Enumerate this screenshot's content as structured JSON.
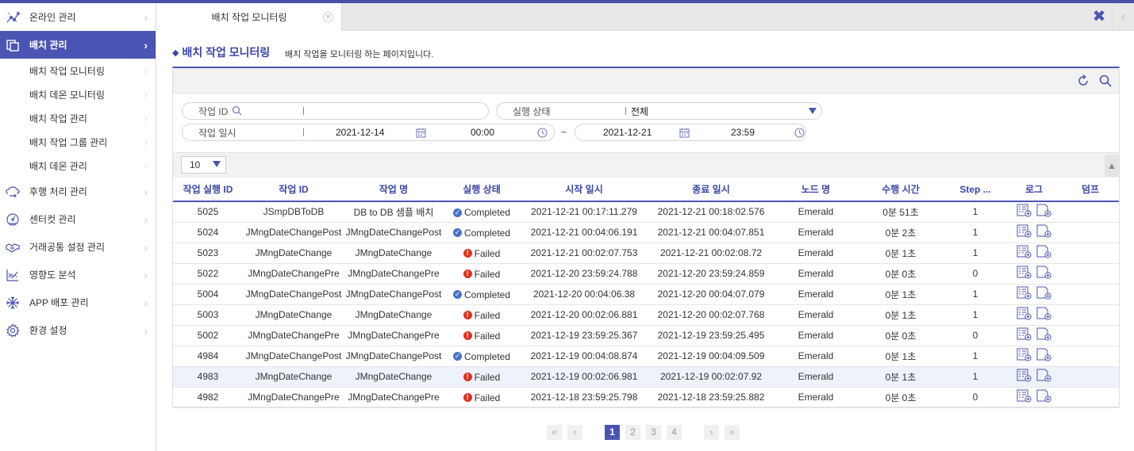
{
  "sidebar": {
    "items": [
      {
        "label": "온라인 관리",
        "icon": "chart-network-icon"
      },
      {
        "label": "배치 관리",
        "icon": "copy-icon",
        "active": true
      },
      {
        "label": "후행 처리 관리",
        "icon": "cloud-flow-icon"
      },
      {
        "label": "센터컷 관리",
        "icon": "gauge-icon"
      },
      {
        "label": "거래공통 설정 관리",
        "icon": "handshake-icon"
      },
      {
        "label": "영향도 분석",
        "icon": "line-chart-icon"
      },
      {
        "label": "APP 배포 관리",
        "icon": "snowflake-icon"
      },
      {
        "label": "환경 설정",
        "icon": "gear-icon"
      }
    ],
    "subitems": [
      "배치 작업 모니터링",
      "배치 데몬 모니터링",
      "배치 작업 관리",
      "배치 작업 그룹 관리",
      "배치 데몬 관리"
    ]
  },
  "tabs": [
    {
      "label": "배치 작업 모니터링"
    }
  ],
  "page": {
    "title": "배치 작업 모니터링",
    "description": "배치 작업을 모니터링 하는 페이지입니다."
  },
  "search": {
    "job_id_label": "작업 ID",
    "job_id_value": "",
    "status_label": "실행 상태",
    "status_value": "전체",
    "date_label": "작업 일시",
    "start_date": "2021-12-14",
    "start_time": "00:00",
    "tilde": "~",
    "end_date": "2021-12-21",
    "end_time": "23:59"
  },
  "grid": {
    "page_size": "10",
    "columns": [
      "작업 실행 ID",
      "작업 ID",
      "작업 명",
      "실행 상태",
      "시작 일시",
      "종료 일시",
      "노드 명",
      "수행 시간",
      "Step ...",
      "로그",
      "덤프"
    ],
    "rows": [
      {
        "id": "5025",
        "job_id": "JSmpDBToDB",
        "job_name": "DB to DB 샘플 배치",
        "status": "Completed",
        "start": "2021-12-21 00:17:11.279",
        "end": "2021-12-21 00:18:02.576",
        "node": "Emerald",
        "duration": "0분 51초",
        "step": "1"
      },
      {
        "id": "5024",
        "job_id": "JMngDateChangePost",
        "job_name": "JMngDateChangePost",
        "status": "Completed",
        "start": "2021-12-21 00:04:06.191",
        "end": "2021-12-21 00:04:07.851",
        "node": "Emerald",
        "duration": "0분 2초",
        "step": "1"
      },
      {
        "id": "5023",
        "job_id": "JMngDateChange",
        "job_name": "JMngDateChange",
        "status": "Failed",
        "start": "2021-12-21 00:02:07.753",
        "end": "2021-12-21 00:02:08.72",
        "node": "Emerald",
        "duration": "0분 1초",
        "step": "1"
      },
      {
        "id": "5022",
        "job_id": "JMngDateChangePre",
        "job_name": "JMngDateChangePre",
        "status": "Failed",
        "start": "2021-12-20 23:59:24.788",
        "end": "2021-12-20 23:59:24.859",
        "node": "Emerald",
        "duration": "0분 0초",
        "step": "0"
      },
      {
        "id": "5004",
        "job_id": "JMngDateChangePost",
        "job_name": "JMngDateChangePost",
        "status": "Completed",
        "start": "2021-12-20 00:04:06.38",
        "end": "2021-12-20 00:04:07.079",
        "node": "Emerald",
        "duration": "0분 1초",
        "step": "1"
      },
      {
        "id": "5003",
        "job_id": "JMngDateChange",
        "job_name": "JMngDateChange",
        "status": "Failed",
        "start": "2021-12-20 00:02:06.881",
        "end": "2021-12-20 00:02:07.768",
        "node": "Emerald",
        "duration": "0분 1초",
        "step": "1"
      },
      {
        "id": "5002",
        "job_id": "JMngDateChangePre",
        "job_name": "JMngDateChangePre",
        "status": "Failed",
        "start": "2021-12-19 23:59:25.367",
        "end": "2021-12-19 23:59:25.495",
        "node": "Emerald",
        "duration": "0분 0초",
        "step": "0"
      },
      {
        "id": "4984",
        "job_id": "JMngDateChangePost",
        "job_name": "JMngDateChangePost",
        "status": "Completed",
        "start": "2021-12-19 00:04:08.874",
        "end": "2021-12-19 00:04:09.509",
        "node": "Emerald",
        "duration": "0분 1초",
        "step": "1"
      },
      {
        "id": "4983",
        "job_id": "JMngDateChange",
        "job_name": "JMngDateChange",
        "status": "Failed",
        "start": "2021-12-19 00:02:06.981",
        "end": "2021-12-19 00:02:07.92",
        "node": "Emerald",
        "duration": "0분 1초",
        "step": "1",
        "highlight": true
      },
      {
        "id": "4982",
        "job_id": "JMngDateChangePre",
        "job_name": "JMngDateChangePre",
        "status": "Failed",
        "start": "2021-12-18 23:59:25.798",
        "end": "2021-12-18 23:59:25.882",
        "node": "Emerald",
        "duration": "0분 0초",
        "step": "0"
      }
    ]
  },
  "pagination": {
    "current": "1",
    "pages": [
      "1",
      "2",
      "3",
      "4"
    ]
  },
  "colors": {
    "accent": "#4a55b3",
    "ok": "#4a6fc8",
    "fail": "#e0301e"
  }
}
